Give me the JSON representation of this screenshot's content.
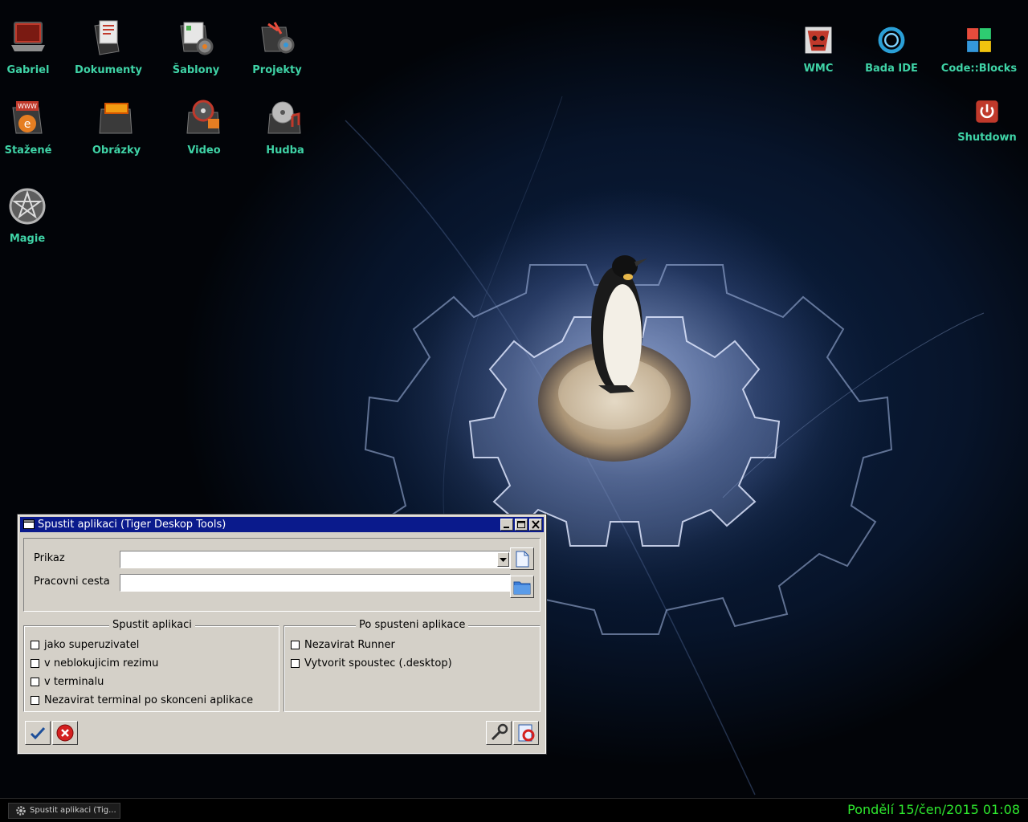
{
  "desktop": {
    "icons_left": [
      {
        "label": "Gabriel",
        "icon": "laptop-icon"
      },
      {
        "label": "Dokumenty",
        "icon": "documents-icon"
      },
      {
        "label": "Šablony",
        "icon": "templates-icon"
      },
      {
        "label": "Projekty",
        "icon": "projects-icon"
      },
      {
        "label": "Stažené",
        "icon": "downloads-icon"
      },
      {
        "label": "Obrázky",
        "icon": "pictures-icon"
      },
      {
        "label": "Video",
        "icon": "video-icon"
      },
      {
        "label": "Hudba",
        "icon": "music-icon"
      },
      {
        "label": "Magie",
        "icon": "pentagram-icon"
      }
    ],
    "icons_right": [
      {
        "label": "WMC",
        "icon": "wmc-icon"
      },
      {
        "label": "Bada IDE",
        "icon": "bada-ide-icon"
      },
      {
        "label": "Code::Blocks",
        "icon": "codeblocks-icon"
      },
      {
        "label": "Shutdown",
        "icon": "power-icon"
      }
    ],
    "label_color": "#3fd3a6"
  },
  "dialog": {
    "title": "Spustit aplikaci (Tiger Deskop Tools)",
    "command_label": "Prikaz",
    "command_value": "",
    "workdir_label": "Pracovni cesta",
    "workdir_value": "",
    "run_group": {
      "legend": "Spustit aplikaci",
      "options": [
        {
          "label": "jako superuzivatel",
          "checked": false
        },
        {
          "label": "v neblokujicim rezimu",
          "checked": false
        },
        {
          "label": "v terminalu",
          "checked": false
        },
        {
          "label": "Nezavirat terminal po skonceni aplikace",
          "checked": false
        }
      ]
    },
    "after_group": {
      "legend": "Po spusteni aplikace",
      "options": [
        {
          "label": "Nezavirat Runner",
          "checked": false
        },
        {
          "label": "Vytvorit spoustec (.desktop)",
          "checked": false
        }
      ]
    },
    "title_bar_color": "#0a1a8c"
  },
  "taskbar": {
    "task_label": "Spustit aplikaci (Tig...",
    "clock": "Pondělí 15/čen/2015 01:08",
    "clock_color": "#2ee82e"
  }
}
